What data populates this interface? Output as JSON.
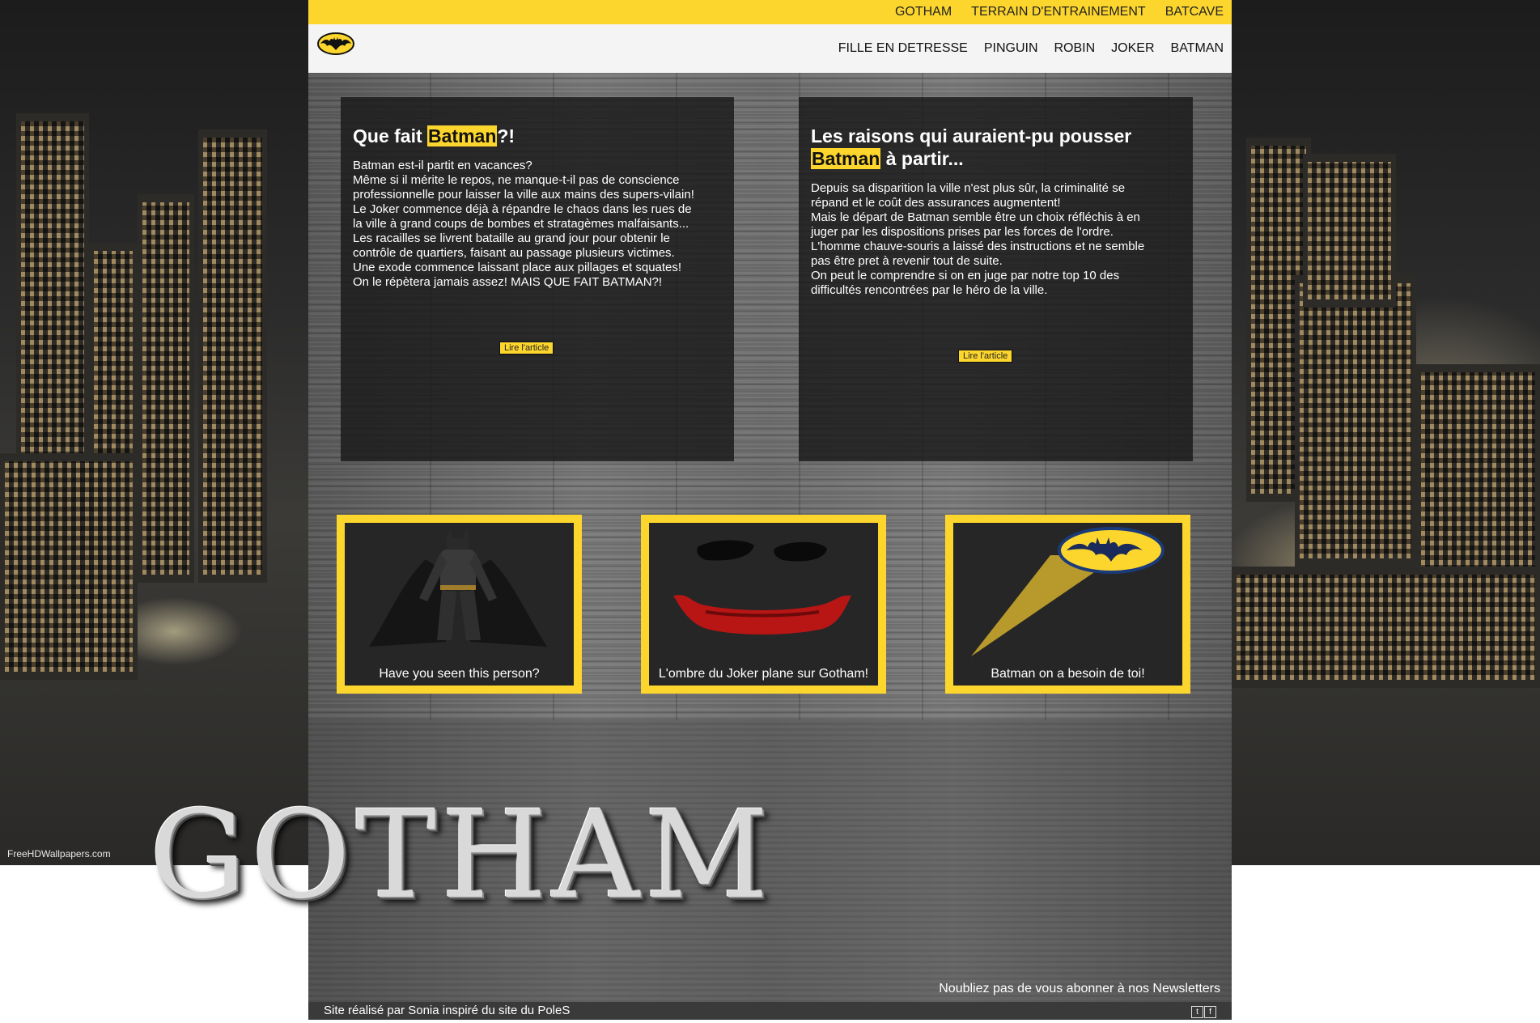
{
  "brand": {
    "accent": "#fcd62d"
  },
  "background": {
    "watermark": "FreeHDWallpapers.com"
  },
  "top_nav": {
    "items": [
      {
        "label": "GOTHAM"
      },
      {
        "label": "TERRAIN D'ENTRAINEMENT"
      },
      {
        "label": "BATCAVE"
      }
    ]
  },
  "main_nav": {
    "logo_icon": "bat-logo-icon",
    "items": [
      {
        "label": "FILLE EN DETRESSE"
      },
      {
        "label": "PINGUIN"
      },
      {
        "label": "ROBIN"
      },
      {
        "label": "JOKER"
      },
      {
        "label": "BATMAN"
      }
    ]
  },
  "articles": [
    {
      "title_pre": "Que fait ",
      "title_highlight": "Batman",
      "title_post": "?!",
      "body": "Batman est-il partit en vacances?\nMême si il mérite le repos, ne manque-t-il pas de conscience\nprofessionnelle pour laisser la ville aux mains des supers-vilain!\nLe Joker commence déjà à répandre le chaos dans les rues de\nla ville à grand coups de bombes et stratagèmes malfaisants...\nLes racailles se livrent bataille au grand jour pour obtenir le\ncontrôle de quartiers, faisant au passage plusieurs victimes.\nUne exode commence laissant place aux pillages et squates!\nOn le répètera jamais assez! MAIS QUE FAIT BATMAN?!",
      "button": "Lire l'article"
    },
    {
      "title_pre": "Les raisons qui auraient-pu pousser",
      "title_highlight": "Batman",
      "title_post": " à partir...",
      "body": "Depuis sa disparition la ville n'est plus sûr, la criminalité se\nrépand et le coût des assurances augmentent!\nMais le départ de Batman semble être un choix réfléchis à en\njuger par les dispositions prises par les forces de l'ordre.\nL'homme chauve-souris a laissé des instructions et ne semble\npas être pret à revenir tout de suite.\nOn peut le comprendre si on en juge par notre top 10 des\ndifficultés rencontrées par le héro de la ville.",
      "button": "Lire l'article"
    }
  ],
  "cards": [
    {
      "caption": "Have you seen this person?",
      "icon": "batman-figure-icon"
    },
    {
      "caption": "L'ombre du Joker plane sur Gotham!",
      "icon": "joker-face-icon"
    },
    {
      "caption": "Batman on a besoin de toi!",
      "icon": "bat-signal-icon"
    }
  ],
  "footer": {
    "logo_text": "GOTHAM",
    "newsletter": "Noubliez pas de vous abonner à nos Newsletters",
    "credit": "Site réalisé par Sonia inspiré du site du PoleS",
    "social": [
      "twitter-icon",
      "facebook-icon"
    ]
  }
}
